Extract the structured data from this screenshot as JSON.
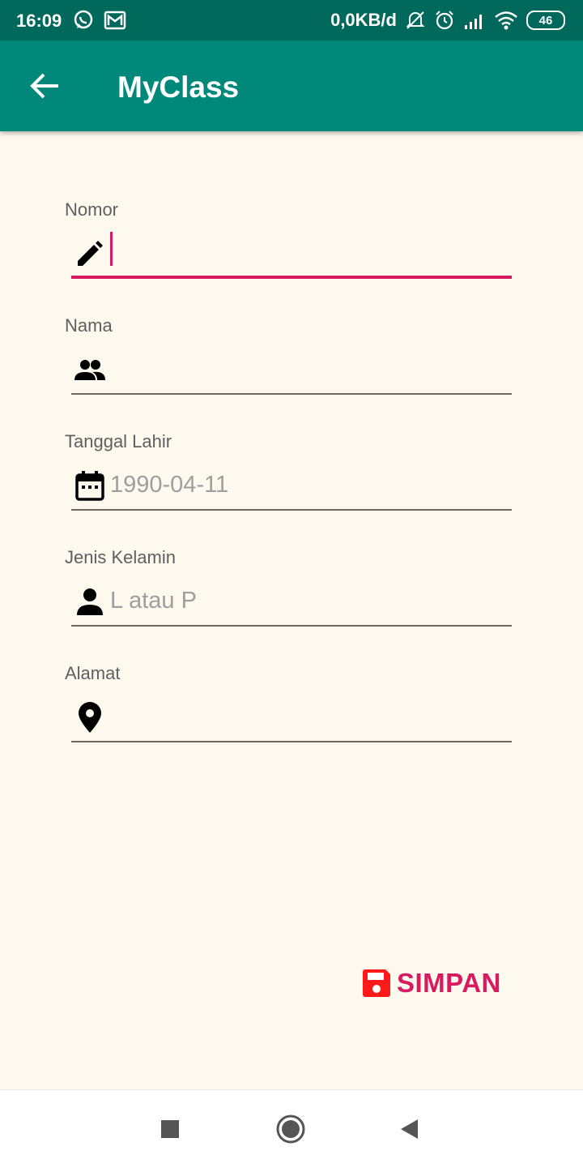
{
  "status_bar": {
    "time": "16:09",
    "speed": "0,0KB/d",
    "battery": "46",
    "icons": [
      "whatsapp-icon",
      "gmail-icon",
      "mute-icon",
      "alarm-icon",
      "signal-icon",
      "wifi-icon",
      "battery-icon"
    ]
  },
  "app_bar": {
    "title": "MyClass",
    "back_icon": "arrow-back-icon",
    "background": "#00897b"
  },
  "form": {
    "fields": [
      {
        "label": "Nomor",
        "value": "",
        "placeholder": "",
        "icon": "pencil-icon",
        "focused": true
      },
      {
        "label": "Nama",
        "value": "",
        "placeholder": "",
        "icon": "people-icon"
      },
      {
        "label": "Tanggal Lahir",
        "value": "",
        "placeholder": "1990-04-11",
        "icon": "calendar-icon"
      },
      {
        "label": "Jenis Kelamin",
        "value": "",
        "placeholder": "L atau P",
        "icon": "person-icon"
      },
      {
        "label": "Alamat",
        "value": "",
        "placeholder": "",
        "icon": "location-pin-icon"
      }
    ]
  },
  "save_button": {
    "label": "SIMPAN",
    "icon": "floppy-disk-icon",
    "color": "#d81b60"
  },
  "nav_bar": {
    "icons": [
      "recents-square-icon",
      "home-circle-icon",
      "back-triangle-icon"
    ]
  },
  "colors": {
    "accent": "#d81b60",
    "status_bar": "#00695c",
    "background": "#fdf9ee"
  }
}
